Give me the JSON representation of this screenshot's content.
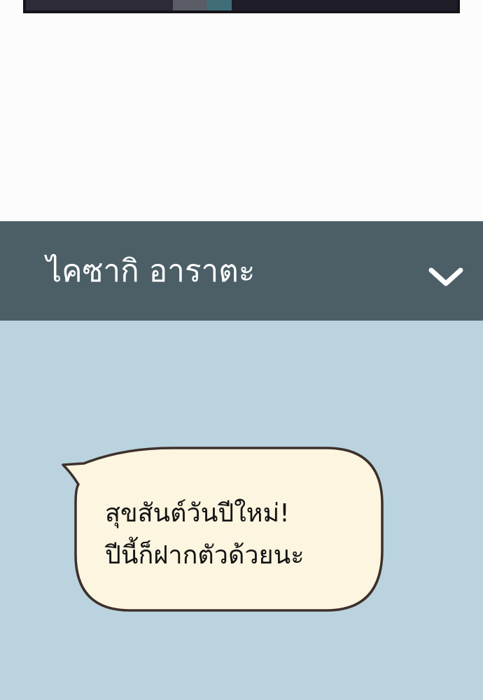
{
  "colors": {
    "page_background": "#fcfcfc",
    "header_background": "#4c5f67",
    "header_text": "#ffffff",
    "chat_background": "#bad3de",
    "bubble_fill": "#fcf5df",
    "bubble_outline": "#3d302c",
    "comic_border": "#161419"
  },
  "chat_header": {
    "character_name": "ไคซากิ อาราตะ",
    "toggle_icon": "chevron-down-icon"
  },
  "speech_bubble": {
    "lines": [
      "สุขสันต์วันปีใหม่!",
      "ปีนี้ก็ฝากตัวด้วยนะ"
    ]
  }
}
